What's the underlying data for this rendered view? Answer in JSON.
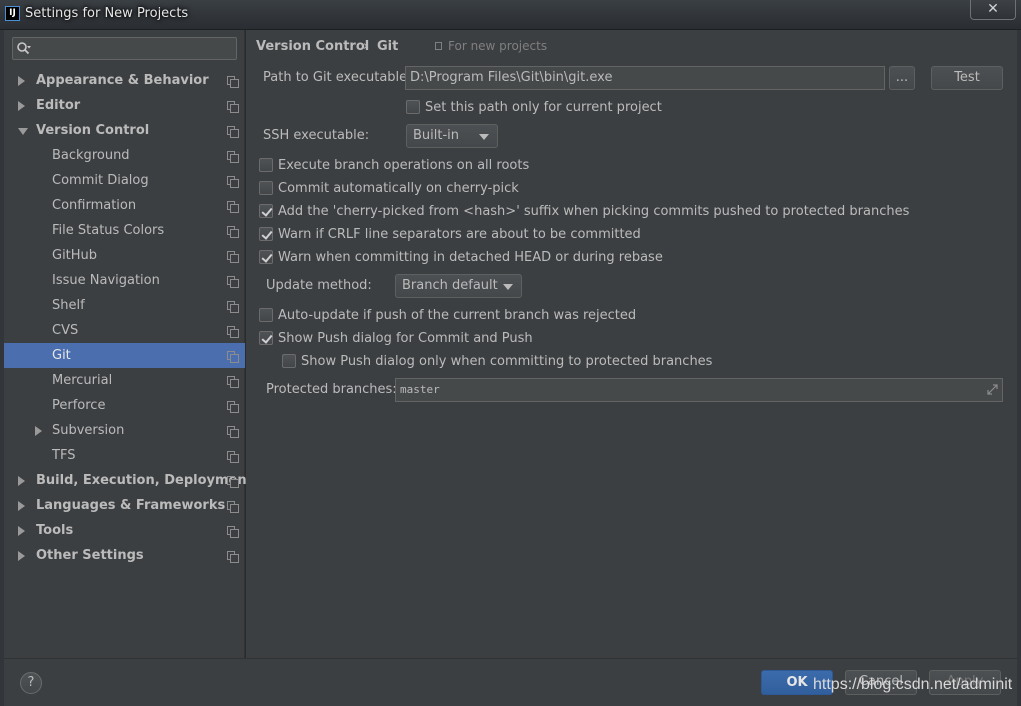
{
  "window": {
    "title": "Settings for New Projects",
    "app_icon": "IJ",
    "close_glyph": "✕"
  },
  "sidebar": {
    "search_placeholder": "",
    "items": [
      {
        "label": "Appearance & Behavior",
        "level": 0,
        "arrow": "right"
      },
      {
        "label": "Editor",
        "level": 0,
        "arrow": "right"
      },
      {
        "label": "Version Control",
        "level": 0,
        "arrow": "down"
      },
      {
        "label": "Background",
        "level": 1
      },
      {
        "label": "Commit Dialog",
        "level": 1
      },
      {
        "label": "Confirmation",
        "level": 1
      },
      {
        "label": "File Status Colors",
        "level": 1
      },
      {
        "label": "GitHub",
        "level": 1
      },
      {
        "label": "Issue Navigation",
        "level": 1
      },
      {
        "label": "Shelf",
        "level": 1
      },
      {
        "label": "CVS",
        "level": 1
      },
      {
        "label": "Git",
        "level": 1,
        "selected": true
      },
      {
        "label": "Mercurial",
        "level": 1
      },
      {
        "label": "Perforce",
        "level": 1
      },
      {
        "label": "Subversion",
        "level": 1,
        "arrow": "right"
      },
      {
        "label": "TFS",
        "level": 1
      },
      {
        "label": "Build, Execution, Deployment",
        "level": 0,
        "arrow": "right"
      },
      {
        "label": "Languages & Frameworks",
        "level": 0,
        "arrow": "right"
      },
      {
        "label": "Tools",
        "level": 0,
        "arrow": "right"
      },
      {
        "label": "Other Settings",
        "level": 0,
        "arrow": "right"
      }
    ]
  },
  "breadcrumb": {
    "parent": "Version Control",
    "separator": "›",
    "current": "Git",
    "note": "For new projects"
  },
  "git": {
    "path_label": "Path to Git executable:",
    "path_value": "D:\\Program Files\\Git\\bin\\git.exe",
    "browse_label": "...",
    "test_label": "Test",
    "set_path_only": "Set this path only for current project",
    "ssh_label": "SSH executable:",
    "ssh_value": "Built-in",
    "checkboxes": [
      {
        "label": "Execute branch operations on all roots",
        "checked": false
      },
      {
        "label": "Commit automatically on cherry-pick",
        "checked": false
      },
      {
        "label": "Add the 'cherry-picked from <hash>' suffix when picking commits pushed to protected branches",
        "checked": true
      },
      {
        "label": "Warn if CRLF line separators are about to be committed",
        "checked": true
      },
      {
        "label": "Warn when committing in detached HEAD or during rebase",
        "checked": true
      }
    ],
    "update_label": "Update method:",
    "update_value": "Branch default",
    "auto_update": {
      "label": "Auto-update if push of the current branch was rejected",
      "checked": false
    },
    "show_push": {
      "label": "Show Push dialog for Commit and Push",
      "checked": true
    },
    "show_push_protected": {
      "label": "Show Push dialog only when committing to protected branches",
      "checked": false
    },
    "protected_label": "Protected branches:",
    "protected_value": "master"
  },
  "footer": {
    "help_label": "?",
    "ok_label": "OK",
    "cancel_label": "Cancel",
    "apply_label": "Apply"
  },
  "watermark": "https://blog.csdn.net/adminit",
  "colors": {
    "selection": "#4b6eaf",
    "panel": "#3c3f41",
    "ok": "#365f9c"
  }
}
